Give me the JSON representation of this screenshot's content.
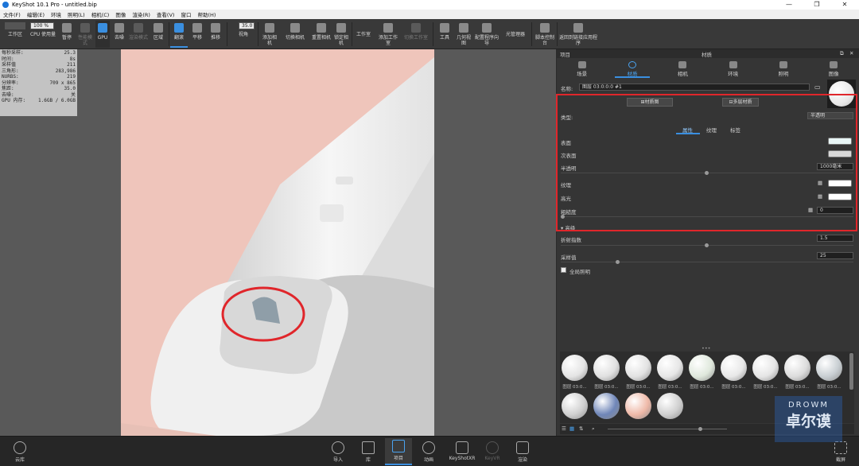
{
  "window": {
    "title": "KeyShot 10.1 Pro  -  untitled.bip",
    "minimize": "—",
    "maximize": "❐",
    "close": "✕"
  },
  "menu": [
    "文件(F)",
    "编辑(E)",
    "环境",
    "照明(L)",
    "相机(C)",
    "图像",
    "渲染(R)",
    "查看(V)",
    "窗口",
    "帮助(H)"
  ],
  "toolbar": {
    "zoom_value": "100 %",
    "fov_value": "35.0",
    "tools": [
      "工作区",
      "CPU 使用量",
      "暂停",
      "性能模式",
      "GPU",
      "去噪",
      "渲染模式",
      "区域",
      "翻滚",
      "平移",
      "推移",
      "视角",
      "添加相机",
      "切换相机",
      "重置相机",
      "锁定相机",
      "工作室",
      "添加工作室",
      "切换工作室",
      "工具",
      "几何视图",
      "配置程序向导",
      "光管理器",
      "脚本控制台",
      "返回到链接应用程序"
    ]
  },
  "hud": [
    {
      "k": "每秒采样:",
      "v": "25.3"
    },
    {
      "k": "时间:",
      "v": "8s"
    },
    {
      "k": "采样值",
      "v": "211"
    },
    {
      "k": "三角形:",
      "v": "283,986"
    },
    {
      "k": "NURBS:",
      "v": "219"
    },
    {
      "k": "分辨率:",
      "v": "709 x 865"
    },
    {
      "k": "焦距:",
      "v": "35.0"
    },
    {
      "k": "去噪:",
      "v": "关"
    },
    {
      "k": "GPU 内存:",
      "v": "1.6GB / 6.0GB"
    }
  ],
  "panel": {
    "header_left": "项目",
    "header_title": "材质",
    "tabs": [
      "场景",
      "材质",
      "相机",
      "环境",
      "照明",
      "图像"
    ],
    "name_label": "名称:",
    "name_value": "图层 03:0:0:0 #1",
    "btn_material_graph": "材质图",
    "btn_multi_material": "多层材质",
    "type_label": "类型:",
    "type_value": "半透明",
    "subtabs": [
      "属性",
      "纹理",
      "标签"
    ],
    "props": {
      "surface": "表面",
      "subsurface": "次表面",
      "translucency": "半透明",
      "translucency_value": "1000毫米",
      "texture": "纹理",
      "specular": "高光",
      "roughness": "粗糙度",
      "roughness_value": "0",
      "section": "高级",
      "ior": "折射指数",
      "ior_value": "1.5",
      "samples": "采样值",
      "samples_value": "25",
      "global_illum": "全局照明"
    },
    "colors": {
      "surface": "#e9f6f6",
      "subsurface": "#d8d8d8",
      "texture": "#ffffff",
      "specular": "#ffffff"
    }
  },
  "library": {
    "dots": "•••",
    "balls": [
      {
        "label": "图层 03:0...",
        "color": "#e4e4e4"
      },
      {
        "label": "图层 03:0...",
        "color": "#e0e0e0"
      },
      {
        "label": "图层 03:0...",
        "color": "#e2e2e2"
      },
      {
        "label": "图层 03:0...",
        "color": "#e6e6e6"
      },
      {
        "label": "图层 03:0...",
        "color": "#dfe8dc"
      },
      {
        "label": "图层 03:0...",
        "color": "#e8e8e8"
      },
      {
        "label": "图层 03:0...",
        "color": "#e5e5e5"
      },
      {
        "label": "图层 03:0...",
        "color": "#dcdcdc"
      },
      {
        "label": "图层 03:0...",
        "color": "#c8ced2"
      },
      {
        "label": "",
        "color": "#d0d0d0"
      },
      {
        "label": "",
        "color": "#6f86b8"
      },
      {
        "label": "",
        "color": "#efb9a8"
      },
      {
        "label": "",
        "color": "#cfcfcf"
      }
    ]
  },
  "bottombar": {
    "left": "云库",
    "items": [
      "导入",
      "库",
      "项目",
      "动画",
      "KeyShotXR",
      "KeyVR",
      "渲染"
    ],
    "right": "截屏"
  },
  "watermark": {
    "line1": "DROWM",
    "line2": "卓尔谟"
  }
}
